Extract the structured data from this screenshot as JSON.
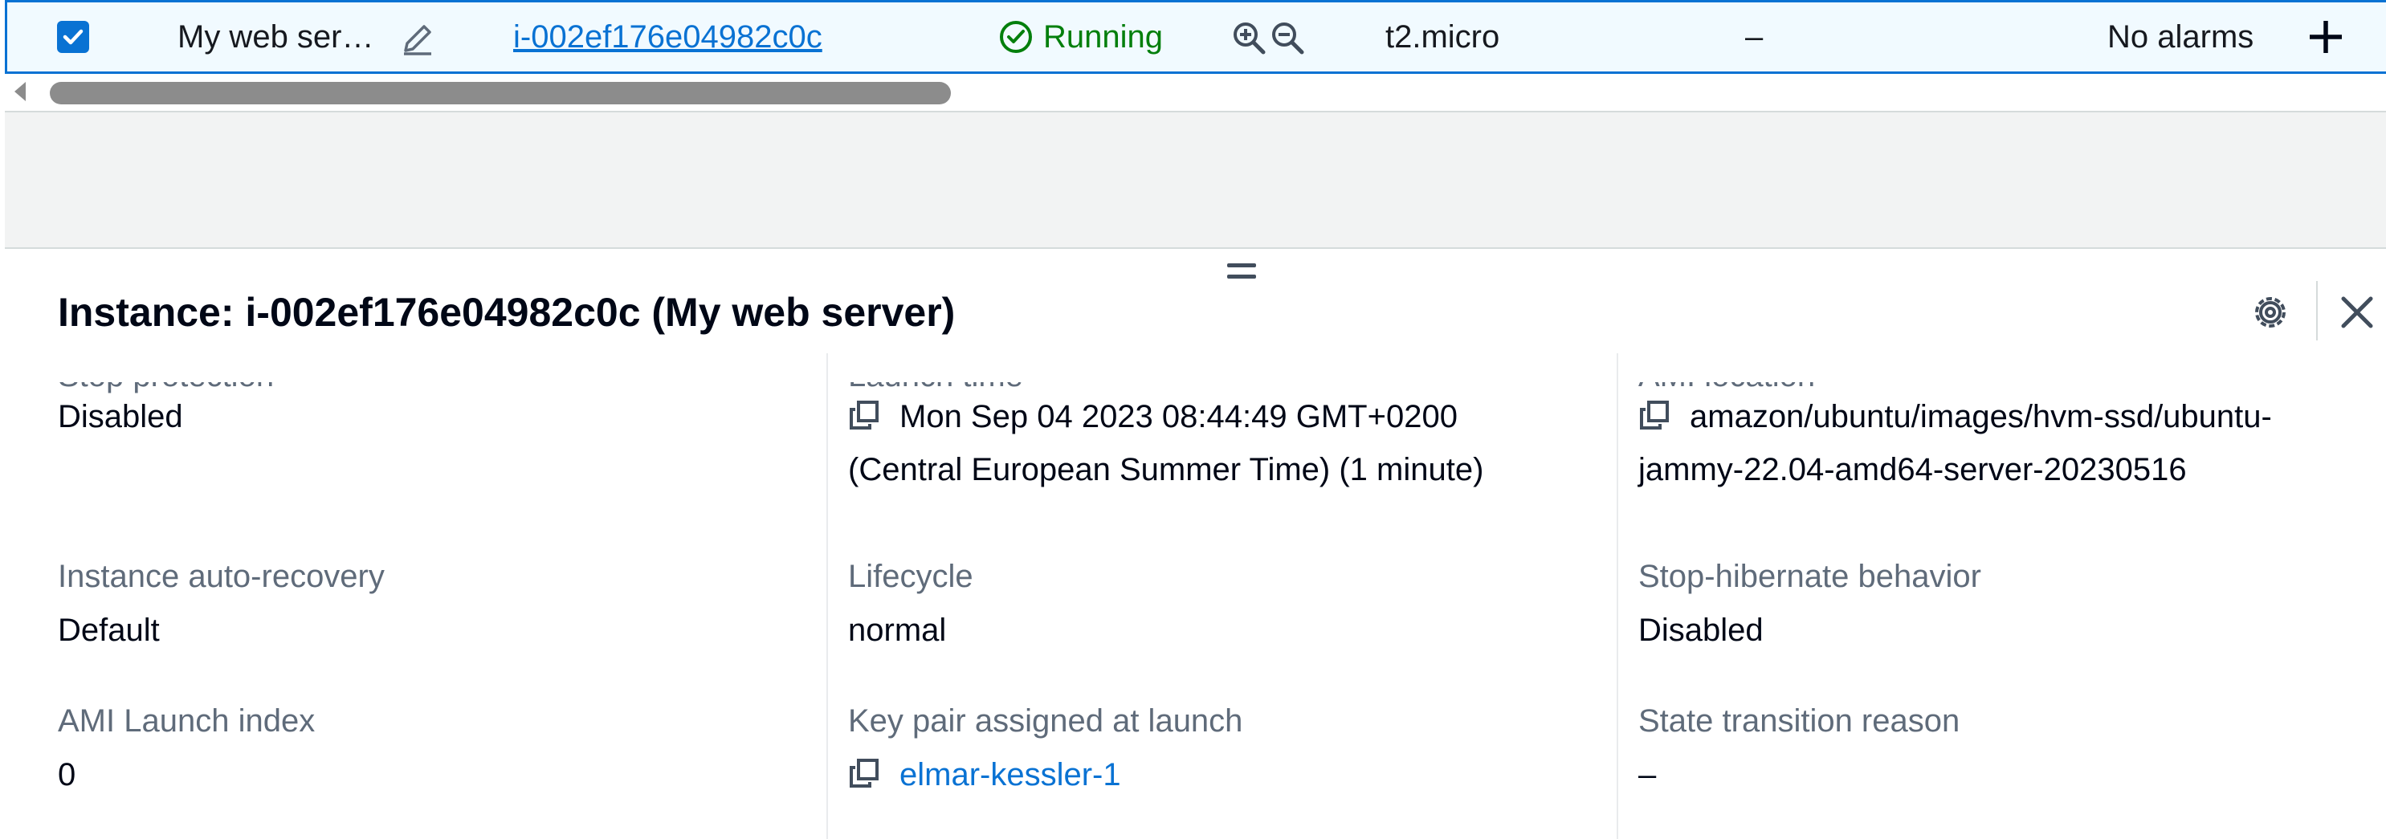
{
  "row": {
    "name": "My web ser…",
    "instance_id": "i-002ef176e04982c0c",
    "state": "Running",
    "instance_type": "t2.micro",
    "status_check": "–",
    "alarm_status": "No alarms"
  },
  "panel": {
    "title": "Instance: i-002ef176e04982c0c (My web server)",
    "col1": [
      {
        "label": "Stop protection",
        "value": "Disabled"
      },
      {
        "label": "Instance auto-recovery",
        "value": "Default"
      },
      {
        "label": "AMI Launch index",
        "value": "0"
      }
    ],
    "col2": [
      {
        "label": "Launch time",
        "value_line1": "Mon Sep 04 2023 08:44:49 GMT+0200",
        "value_line2": "(Central European Summer Time) (1 minute)"
      },
      {
        "label": "Lifecycle",
        "value": "normal"
      },
      {
        "label": "Key pair assigned at launch",
        "value": "elmar-kessler-1"
      }
    ],
    "col3": [
      {
        "label": "AMI location",
        "value_line1": "amazon/ubuntu/images/hvm-ssd/ubuntu-",
        "value_line2": "jammy-22.04-amd64-server-20230516"
      },
      {
        "label": "Stop-hibernate behavior",
        "value": "Disabled"
      },
      {
        "label": "State transition reason",
        "value": "–"
      }
    ]
  },
  "colors": {
    "accent": "#0972d3",
    "running": "#037f0c",
    "label": "#5f6b7a",
    "grey_bg": "#f2f3f3"
  },
  "icons": [
    "checkbox-checked-icon",
    "edit-pencil-icon",
    "status-running-icon",
    "zoom-in-icon",
    "zoom-out-icon",
    "add-icon",
    "drag-handle-icon",
    "settings-icon",
    "close-icon",
    "copy-icon"
  ]
}
